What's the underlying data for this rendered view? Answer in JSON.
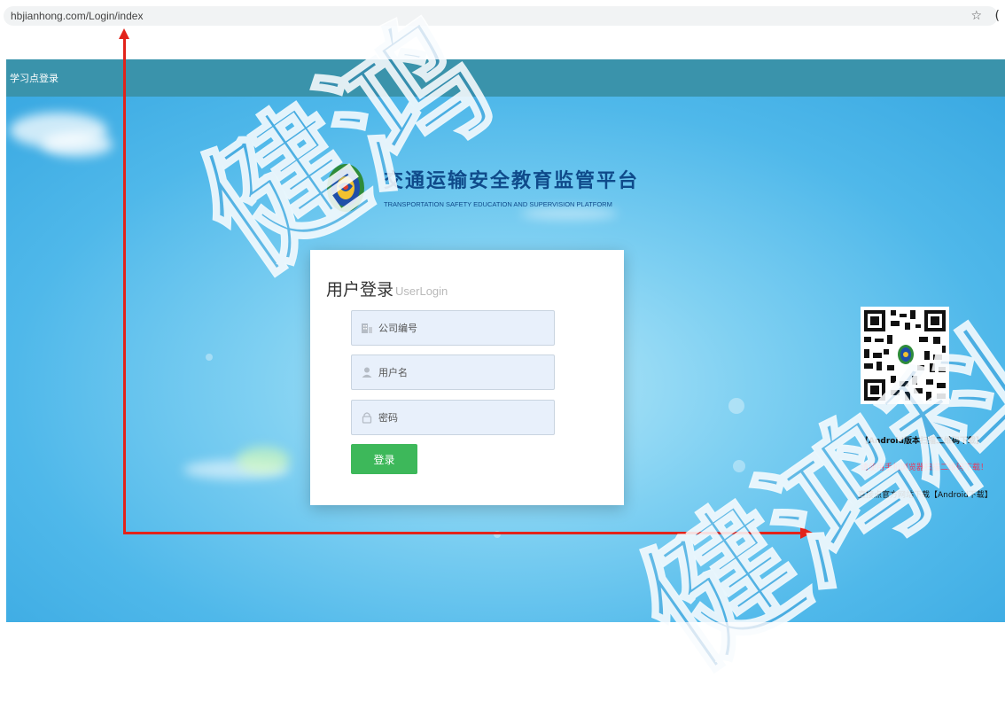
{
  "browser": {
    "url": "hbjianhong.com/Login/index",
    "star_icon": "star-icon"
  },
  "header": {
    "title": "学习点登录"
  },
  "brand": {
    "title": "交通运输安全教育监管平台",
    "subtitle": "TRANSPORTATION SAFETY EDUCATION AND SUPERVISION PLATFORM",
    "logo_icon": "shield-emblem-icon"
  },
  "login": {
    "title": "用户登录",
    "subtitle": "UserLogin",
    "company_placeholder": "公司编号",
    "username_placeholder": "用户名",
    "password_placeholder": "密码",
    "company_icon": "building-icon",
    "username_icon": "user-icon",
    "password_icon": "lock-icon",
    "button_label": "登录"
  },
  "download": {
    "qr_label": "【Android版本扫描二维码下载】",
    "hint": "请使用手机浏览器扫描二维码下载！",
    "link_text": "直接点官方网站下载【Android下载】"
  },
  "watermark": {
    "text_1": "健鸿",
    "text_2": "健鸿科"
  },
  "colors": {
    "header_bg": "#3a93ab",
    "brand_blue": "#0f4a8a",
    "button_green": "#3db85a",
    "annotation_red": "#e2231a",
    "hint_pink": "#e8375c"
  }
}
